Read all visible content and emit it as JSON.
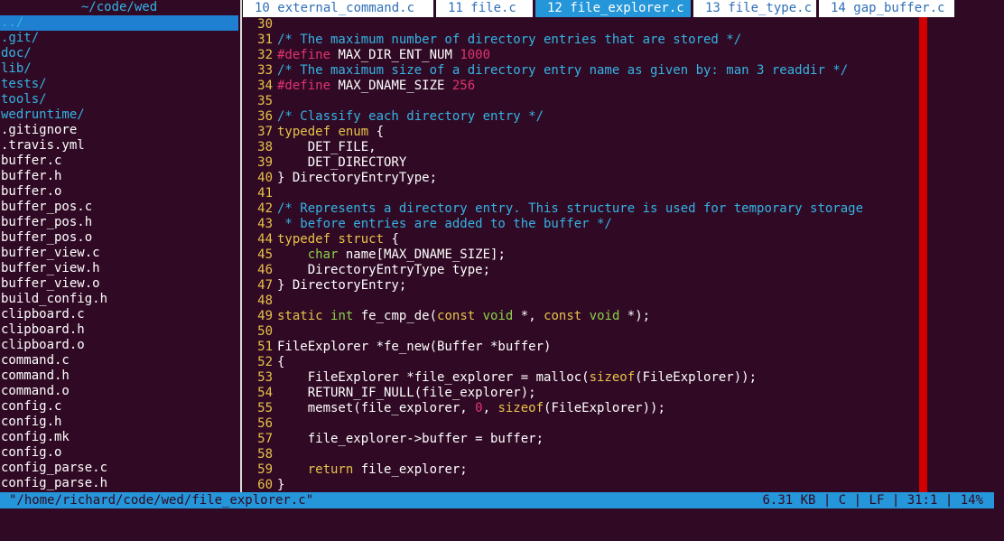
{
  "sidebar": {
    "title": "~/code/wed",
    "items": [
      {
        "label": "../",
        "dir": true,
        "selected": true
      },
      {
        "label": ".git/",
        "dir": true
      },
      {
        "label": "doc/",
        "dir": true
      },
      {
        "label": "lib/",
        "dir": true
      },
      {
        "label": "tests/",
        "dir": true
      },
      {
        "label": "tools/",
        "dir": true
      },
      {
        "label": "wedruntime/",
        "dir": true
      },
      {
        "label": ".gitignore"
      },
      {
        "label": ".travis.yml"
      },
      {
        "label": "buffer.c"
      },
      {
        "label": "buffer.h"
      },
      {
        "label": "buffer.o"
      },
      {
        "label": "buffer_pos.c"
      },
      {
        "label": "buffer_pos.h"
      },
      {
        "label": "buffer_pos.o"
      },
      {
        "label": "buffer_view.c"
      },
      {
        "label": "buffer_view.h"
      },
      {
        "label": "buffer_view.o"
      },
      {
        "label": "build_config.h"
      },
      {
        "label": "clipboard.c"
      },
      {
        "label": "clipboard.h"
      },
      {
        "label": "clipboard.o"
      },
      {
        "label": "command.c"
      },
      {
        "label": "command.h"
      },
      {
        "label": "command.o"
      },
      {
        "label": "config.c"
      },
      {
        "label": "config.h"
      },
      {
        "label": "config.mk"
      },
      {
        "label": "config.o"
      },
      {
        "label": "config_parse.c"
      },
      {
        "label": "config_parse.h"
      }
    ]
  },
  "tabs": [
    {
      "label": "10 external_command.c"
    },
    {
      "label": "11 file.c"
    },
    {
      "label": "12 file_explorer.c",
      "active": true
    },
    {
      "label": "13 file_type.c"
    },
    {
      "label": "14 gap_buffer.c"
    }
  ],
  "editor": {
    "lines": [
      {
        "n": "30",
        "segs": []
      },
      {
        "n": "31",
        "segs": [
          {
            "t": "/* The maximum number of directory entries that are stored */",
            "c": "cmt"
          }
        ]
      },
      {
        "n": "32",
        "segs": [
          {
            "t": "#define",
            "c": "pp"
          },
          {
            "t": " MAX_DIR_ENT_NUM "
          },
          {
            "t": "1000",
            "c": "num"
          }
        ]
      },
      {
        "n": "33",
        "segs": [
          {
            "t": "/* The maximum size of a directory entry name as given by: man 3 readdir */",
            "c": "cmt"
          }
        ]
      },
      {
        "n": "34",
        "segs": [
          {
            "t": "#define",
            "c": "pp"
          },
          {
            "t": " MAX_DNAME_SIZE "
          },
          {
            "t": "256",
            "c": "num"
          }
        ]
      },
      {
        "n": "35",
        "segs": []
      },
      {
        "n": "36",
        "segs": [
          {
            "t": "/* Classify each directory entry */",
            "c": "cmt"
          }
        ]
      },
      {
        "n": "37",
        "segs": [
          {
            "t": "typedef",
            "c": "kw"
          },
          {
            "t": " "
          },
          {
            "t": "enum",
            "c": "kw"
          },
          {
            "t": " {"
          }
        ]
      },
      {
        "n": "38",
        "segs": [
          {
            "t": "    DET_FILE,"
          }
        ]
      },
      {
        "n": "39",
        "segs": [
          {
            "t": "    DET_DIRECTORY"
          }
        ]
      },
      {
        "n": "40",
        "segs": [
          {
            "t": "} DirectoryEntryType;"
          }
        ]
      },
      {
        "n": "41",
        "segs": []
      },
      {
        "n": "42",
        "segs": [
          {
            "t": "/* Represents a directory entry. This structure is used for temporary storage",
            "c": "cmt"
          }
        ]
      },
      {
        "n": "43",
        "segs": [
          {
            "t": " * before entries are added to the buffer */",
            "c": "cmt"
          }
        ]
      },
      {
        "n": "44",
        "segs": [
          {
            "t": "typedef",
            "c": "kw"
          },
          {
            "t": " "
          },
          {
            "t": "struct",
            "c": "kw"
          },
          {
            "t": " {"
          }
        ]
      },
      {
        "n": "45",
        "segs": [
          {
            "t": "    "
          },
          {
            "t": "char",
            "c": "typ"
          },
          {
            "t": " name[MAX_DNAME_SIZE];"
          }
        ]
      },
      {
        "n": "46",
        "segs": [
          {
            "t": "    DirectoryEntryType type;"
          }
        ]
      },
      {
        "n": "47",
        "segs": [
          {
            "t": "} DirectoryEntry;"
          }
        ]
      },
      {
        "n": "48",
        "segs": []
      },
      {
        "n": "49",
        "segs": [
          {
            "t": "static",
            "c": "kw"
          },
          {
            "t": " "
          },
          {
            "t": "int",
            "c": "typ"
          },
          {
            "t": " fe_cmp_de("
          },
          {
            "t": "const",
            "c": "kw"
          },
          {
            "t": " "
          },
          {
            "t": "void",
            "c": "typ"
          },
          {
            "t": " *, "
          },
          {
            "t": "const",
            "c": "kw"
          },
          {
            "t": " "
          },
          {
            "t": "void",
            "c": "typ"
          },
          {
            "t": " *);"
          }
        ]
      },
      {
        "n": "50",
        "segs": []
      },
      {
        "n": "51",
        "segs": [
          {
            "t": "FileExplorer *fe_new(Buffer *buffer)"
          }
        ]
      },
      {
        "n": "52",
        "segs": [
          {
            "t": "{"
          }
        ]
      },
      {
        "n": "53",
        "segs": [
          {
            "t": "    FileExplorer *file_explorer = malloc("
          },
          {
            "t": "sizeof",
            "c": "kw"
          },
          {
            "t": "(FileExplorer));"
          }
        ]
      },
      {
        "n": "54",
        "segs": [
          {
            "t": "    RETURN_IF_NULL(file_explorer);"
          }
        ]
      },
      {
        "n": "55",
        "segs": [
          {
            "t": "    memset(file_explorer, "
          },
          {
            "t": "0",
            "c": "num"
          },
          {
            "t": ", "
          },
          {
            "t": "sizeof",
            "c": "kw"
          },
          {
            "t": "(FileExplorer));"
          }
        ]
      },
      {
        "n": "56",
        "segs": []
      },
      {
        "n": "57",
        "segs": [
          {
            "t": "    file_explorer->buffer = buffer;"
          }
        ]
      },
      {
        "n": "58",
        "segs": []
      },
      {
        "n": "59",
        "segs": [
          {
            "t": "    "
          },
          {
            "t": "return",
            "c": "kw"
          },
          {
            "t": " file_explorer;"
          }
        ]
      },
      {
        "n": "60",
        "segs": [
          {
            "t": "}"
          }
        ]
      }
    ]
  },
  "status": {
    "path": "\"/home/richard/code/wed/file_explorer.c\"",
    "size": "6.31 KB",
    "lang": "C",
    "eol": "LF",
    "pos": "31:1",
    "percent": "14%"
  },
  "colors": {
    "background": "#300a24",
    "accent": "#2596d9",
    "ruler": "#d00000"
  }
}
